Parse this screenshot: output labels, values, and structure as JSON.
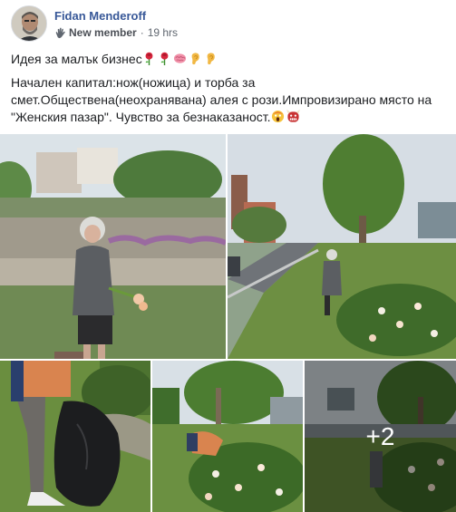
{
  "post": {
    "author": "Fidan Menderoff",
    "badge": "New member",
    "separator": "·",
    "time": "19 hrs",
    "line1": "Идея за малък бизнес",
    "line1_emojis": [
      "rose-emoji",
      "rose-emoji",
      "brain-emoji",
      "ear-emoji",
      "ear-emoji"
    ],
    "line2": "Начален капитал:нож(ножица) и торба за смет.Обществена(неохранявана) алея с рози.Импровизирано място на \"Женския пазар\". Чувство за безнаказаност.",
    "line2_emojis": [
      "screaming-face-emoji",
      "ogre-emoji"
    ]
  },
  "photos": {
    "items": [
      "photo-woman-holding-cut-roses",
      "photo-woman-picking-roses-by-road",
      "photo-person-with-trash-bag",
      "photo-person-bending-over-rose-bed",
      "photo-person-in-rose-alley"
    ],
    "more_count": "+2"
  },
  "colors": {
    "author": "#385898",
    "meta": "#606770",
    "text": "#1c1e21"
  }
}
